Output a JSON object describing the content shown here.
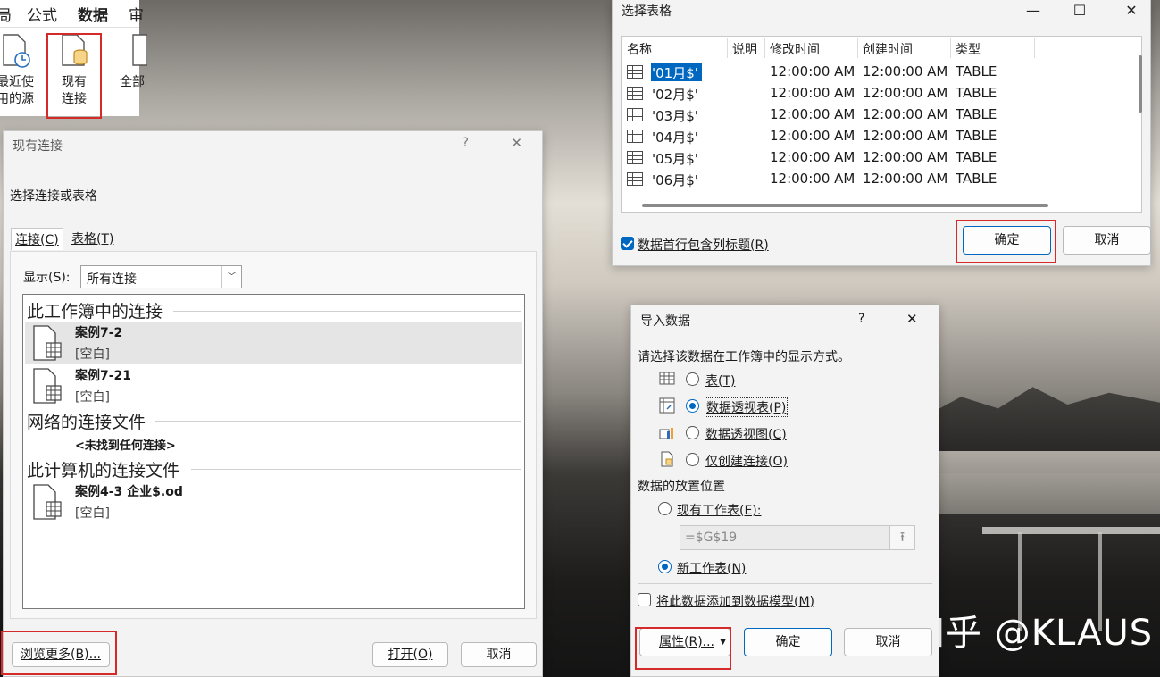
{
  "ribbon": {
    "tabs": [
      {
        "label": "局",
        "active": false
      },
      {
        "label": "公式",
        "active": false
      },
      {
        "label": "数据",
        "active": true
      },
      {
        "label": "审",
        "active": false
      }
    ],
    "buttons": [
      {
        "label_line1": "最近使",
        "label_line2": "用的源"
      },
      {
        "label_line1": "现有",
        "label_line2": "连接"
      },
      {
        "label_line1": "全部",
        "label_line2": ""
      }
    ]
  },
  "existing_connections": {
    "title": "现有连接",
    "help": "?",
    "close": "✕",
    "heading": "选择连接或表格",
    "tabs": [
      "连接(C)",
      "表格(T)"
    ],
    "show_label": "显示(S):",
    "show_value": "所有连接",
    "groups": [
      {
        "title": "此工作簿中的连接",
        "items": [
          {
            "name": "案例7-2",
            "desc": "[空白]",
            "selected": true
          },
          {
            "name": "案例7-21",
            "desc": "[空白]",
            "selected": false
          }
        ]
      },
      {
        "title": "网络的连接文件",
        "empty": "<未找到任何连接>"
      },
      {
        "title": "此计算机的连接文件",
        "items": [
          {
            "name": "案例4-3 企业$.od",
            "desc": "[空白]",
            "selected": false
          }
        ]
      }
    ],
    "browse_button": "浏览更多(B)...",
    "open_button": "打开(O)",
    "cancel_button": "取消"
  },
  "select_table": {
    "title": "选择表格",
    "controls": [
      "—",
      "☐",
      "✕"
    ],
    "columns": [
      "名称",
      "说明",
      "修改时间",
      "创建时间",
      "类型"
    ],
    "rows": [
      {
        "name": "'01月$'",
        "desc": "",
        "modified": "12:00:00 AM",
        "created": "12:00:00 AM",
        "type": "TABLE",
        "selected": true
      },
      {
        "name": "'02月$'",
        "desc": "",
        "modified": "12:00:00 AM",
        "created": "12:00:00 AM",
        "type": "TABLE",
        "selected": false
      },
      {
        "name": "'03月$'",
        "desc": "",
        "modified": "12:00:00 AM",
        "created": "12:00:00 AM",
        "type": "TABLE",
        "selected": false
      },
      {
        "name": "'04月$'",
        "desc": "",
        "modified": "12:00:00 AM",
        "created": "12:00:00 AM",
        "type": "TABLE",
        "selected": false
      },
      {
        "name": "'05月$'",
        "desc": "",
        "modified": "12:00:00 AM",
        "created": "12:00:00 AM",
        "type": "TABLE",
        "selected": false
      },
      {
        "name": "'06月$'",
        "desc": "",
        "modified": "12:00:00 AM",
        "created": "12:00:00 AM",
        "type": "TABLE",
        "selected": false
      }
    ],
    "header_checkbox_label": "数据首行包含列标题(R)",
    "header_checkbox_checked": true,
    "ok_button": "确定",
    "cancel_button": "取消"
  },
  "import_data": {
    "title": "导入数据",
    "help": "?",
    "close": "✕",
    "prompt": "请选择该数据在工作簿中的显示方式。",
    "view_options": [
      {
        "label": "表(T)",
        "checked": false,
        "icon": "table-icon"
      },
      {
        "label": "数据透视表(P)",
        "checked": true,
        "icon": "pivot-table-icon"
      },
      {
        "label": "数据透视图(C)",
        "checked": false,
        "icon": "pivot-chart-icon"
      },
      {
        "label": "仅创建连接(O)",
        "checked": false,
        "icon": "connection-only-icon"
      }
    ],
    "placement_heading": "数据的放置位置",
    "existing_sheet_label": "现有工作表(E):",
    "existing_sheet_checked": false,
    "ref_value": "=$G$19",
    "new_sheet_label": "新工作表(N)",
    "new_sheet_checked": true,
    "model_checkbox_label": "将此数据添加到数据模型(M)",
    "model_checkbox_checked": false,
    "properties_button": "属性(R)...",
    "ok_button": "确定",
    "cancel_button": "取消"
  },
  "watermark": "知乎 @KLAUS",
  "colors": {
    "accent": "#0067c0",
    "highlight": "#d42a2a",
    "excel_green": "#1a7343"
  }
}
